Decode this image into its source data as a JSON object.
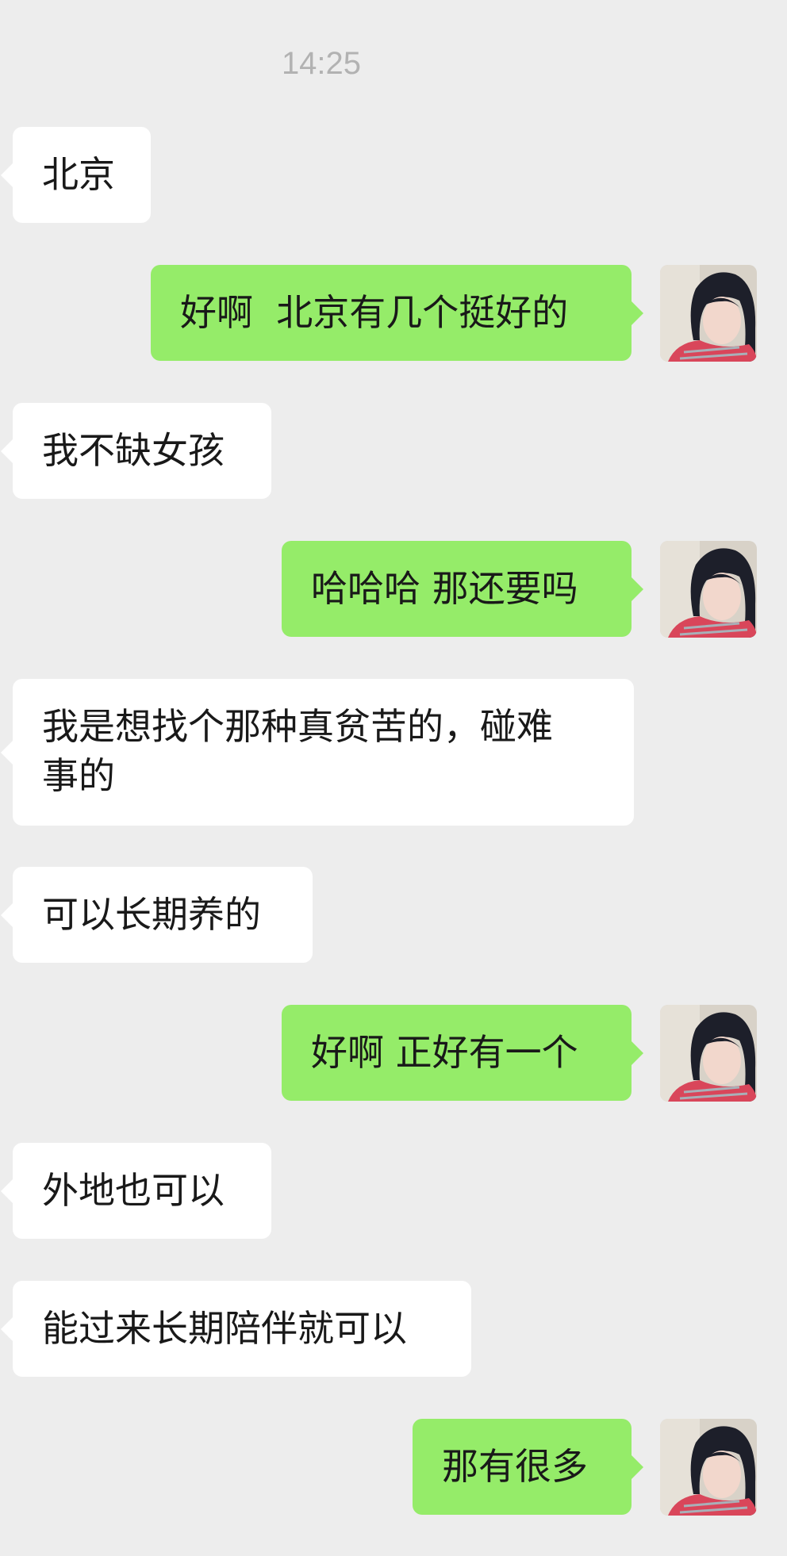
{
  "chat": {
    "timestamp": "14:25",
    "messages": [
      {
        "side": "left",
        "text": "北京"
      },
      {
        "side": "right",
        "text": "好啊  北京有几个挺好的"
      },
      {
        "side": "left",
        "text": "我不缺女孩"
      },
      {
        "side": "right",
        "text": "哈哈哈 那还要吗"
      },
      {
        "side": "left",
        "text": "我是想找个那种真贫苦的，碰难\n事的"
      },
      {
        "side": "left",
        "text": "可以长期养的"
      },
      {
        "side": "right",
        "text": "好啊 正好有一个"
      },
      {
        "side": "left",
        "text": "外地也可以"
      },
      {
        "side": "left",
        "text": "能过来长期陪伴就可以"
      },
      {
        "side": "right",
        "text": "那有很多"
      }
    ]
  },
  "avatar_icon": "user-avatar-photo",
  "colors": {
    "background": "#ededed",
    "incoming_bubble": "#ffffff",
    "outgoing_bubble": "#95ec69",
    "timestamp": "#b2b2b2",
    "text": "#191919"
  }
}
